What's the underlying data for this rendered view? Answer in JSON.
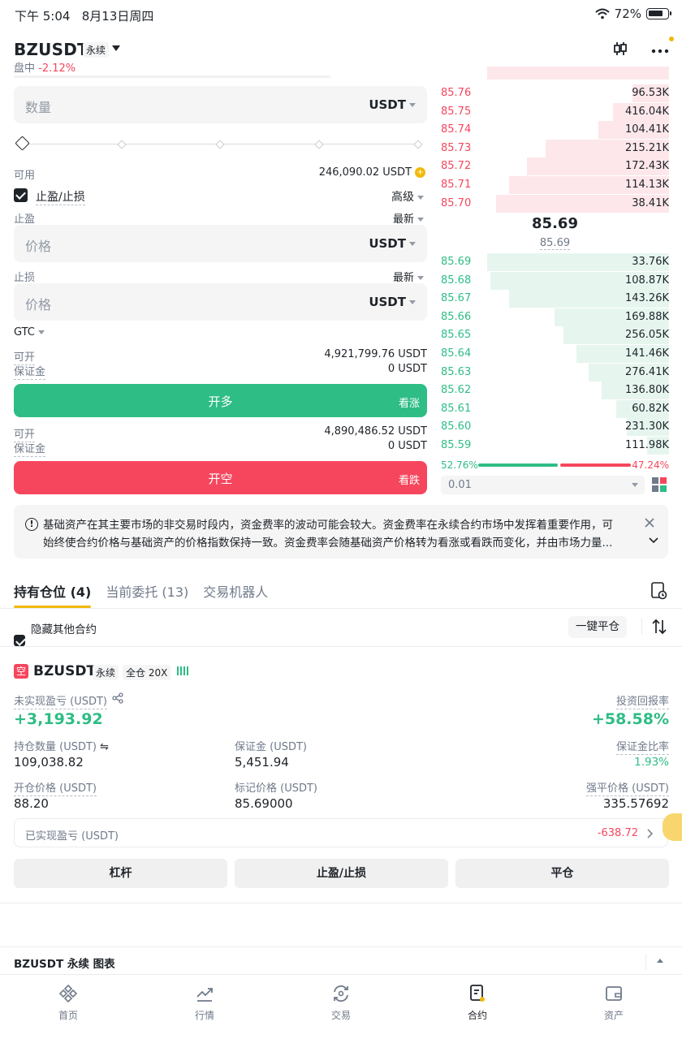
{
  "status": {
    "time": "下午 5:04",
    "date": "8月13日周四",
    "battery": "72%"
  },
  "header": {
    "symbol": "BZUSDT",
    "type_tag": "永续",
    "session": "盘中",
    "change": "-2.12%"
  },
  "form": {
    "qty_placeholder": "数量",
    "qty_unit": "USDT",
    "available_label": "可用",
    "available_value": "246,090.02 USDT",
    "tpsl_label": "止盈/止损",
    "advanced_label": "高级",
    "tp_label": "止盈",
    "tp_trigger": "最新",
    "tp_placeholder": "价格",
    "tp_unit": "USDT",
    "sl_label": "止损",
    "sl_trigger": "最新",
    "sl_placeholder": "价格",
    "sl_unit": "USDT",
    "tif": "GTC",
    "long_open_label": "可开",
    "long_open_value": "4,921,799.76 USDT",
    "long_margin_label": "保证金",
    "long_margin_value": "0 USDT",
    "long_button": "开多",
    "long_sub": "看涨",
    "short_open_label": "可开",
    "short_open_value": "4,890,486.52 USDT",
    "short_margin_label": "保证金",
    "short_margin_value": "0 USDT",
    "short_button": "开空",
    "short_sub": "看跌"
  },
  "orderbook": {
    "asks": [
      {
        "price": "85.76",
        "qty": "96.53K",
        "depth": 0.8
      },
      {
        "price": "85.75",
        "qty": "416.04K",
        "depth": 0.69
      },
      {
        "price": "85.74",
        "qty": "104.41K",
        "depth": 0.61
      },
      {
        "price": "85.73",
        "qty": "215.21K",
        "depth": 0.32
      },
      {
        "price": "85.72",
        "qty": "172.43K",
        "depth": 0.22
      },
      {
        "price": "85.71",
        "qty": "114.13K",
        "depth": 0.12
      },
      {
        "price": "85.70",
        "qty": "38.41K",
        "depth": 0.05
      }
    ],
    "last_price": "85.69",
    "mark_price": "85.69",
    "bids": [
      {
        "price": "85.69",
        "qty": "33.76K",
        "depth": 0.0
      },
      {
        "price": "85.68",
        "qty": "108.87K",
        "depth": 0.02
      },
      {
        "price": "85.67",
        "qty": "143.26K",
        "depth": 0.12
      },
      {
        "price": "85.66",
        "qty": "169.88K",
        "depth": 0.37
      },
      {
        "price": "85.65",
        "qty": "256.05K",
        "depth": 0.42
      },
      {
        "price": "85.64",
        "qty": "141.46K",
        "depth": 0.49
      },
      {
        "price": "85.63",
        "qty": "276.41K",
        "depth": 0.56
      },
      {
        "price": "85.62",
        "qty": "136.80K",
        "depth": 0.63
      },
      {
        "price": "85.61",
        "qty": "60.82K",
        "depth": 0.71
      },
      {
        "price": "85.60",
        "qty": "231.30K",
        "depth": 0.77
      },
      {
        "price": "85.59",
        "qty": "111.98K",
        "depth": 0.88
      }
    ],
    "buy_ratio": "52.76%",
    "sell_ratio": "47.24%",
    "precision": "0.01"
  },
  "notice": {
    "text": "基础资产在其主要市场的非交易时段内，资金费率的波动可能会较大。资金费率在永续合约市场中发挥着重要作用，可始终使合约价格与基础资产的价格指数保持一致。资金费率会随基础资产价格转为看涨或看跌而变化，并由市场力量..."
  },
  "tabs": {
    "positions": "持有仓位 (4)",
    "orders": "当前委托 (13)",
    "bots": "交易机器人"
  },
  "filter": {
    "hide_others": "隐藏其他合约",
    "close_all": "一键平仓"
  },
  "position": {
    "side_tag": "空",
    "symbol": "BZUSDT",
    "type_tag": "永续",
    "margin_tag": "全仓 20X",
    "upnl_label": "未实现盈亏 (USDT)",
    "upnl_value": "+3,193.92",
    "roi_label": "投资回报率",
    "roi_value": "+58.58%",
    "size_label": "持仓数量 (USDT)",
    "size_value": "109,038.82",
    "margin_label": "保证金 (USDT)",
    "margin_value": "5,451.94",
    "mratio_label": "保证金比率",
    "mratio_value": "1.93%",
    "entry_label": "开仓价格 (USDT)",
    "entry_value": "88.20",
    "mark_label": "标记价格 (USDT)",
    "mark_value": "85.69000",
    "liq_label": "强平价格 (USDT)",
    "liq_value": "335.57692",
    "realized_label": "已实现盈亏 (USDT)",
    "realized_value": "-638.72",
    "btn_leverage": "杠杆",
    "btn_tpsl": "止盈/止损",
    "btn_close": "平仓"
  },
  "chart_bar": {
    "label": "BZUSDT 永续 图表"
  },
  "nav": [
    {
      "label": "首页",
      "icon": "home-icon"
    },
    {
      "label": "行情",
      "icon": "markets-icon"
    },
    {
      "label": "交易",
      "icon": "trade-icon"
    },
    {
      "label": "合约",
      "icon": "futures-icon"
    },
    {
      "label": "资产",
      "icon": "wallet-icon"
    }
  ]
}
